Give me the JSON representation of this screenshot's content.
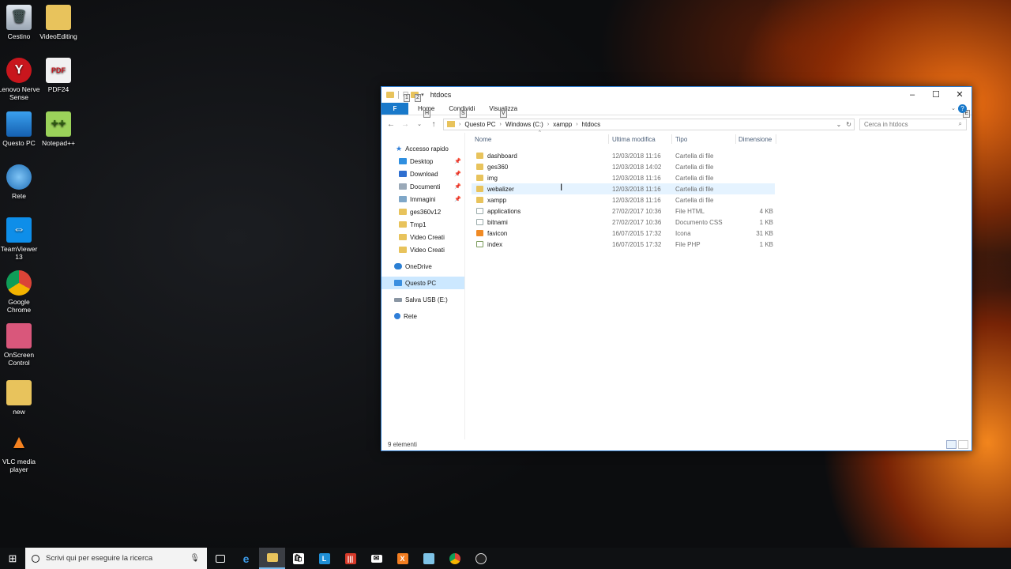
{
  "desktop": {
    "icons": [
      {
        "label": "Cestino",
        "icon": "recycle-bin-icon"
      },
      {
        "label": "VideoEditing",
        "icon": "folder-icon"
      },
      {
        "label": "Lenovo Nerve Sense",
        "icon": "lenovo-nerve-sense-icon"
      },
      {
        "label": "PDF24",
        "icon": "pdf24-icon"
      },
      {
        "label": "Questo PC",
        "icon": "this-pc-icon"
      },
      {
        "label": "Notepad++",
        "icon": "notepad-plus-plus-icon"
      },
      {
        "label": "Rete",
        "icon": "network-icon"
      },
      {
        "label": "TeamViewer 13",
        "icon": "teamviewer-icon"
      },
      {
        "label": "Google Chrome",
        "icon": "chrome-icon"
      },
      {
        "label": "OnScreen Control",
        "icon": "onscreen-control-icon"
      },
      {
        "label": "new",
        "icon": "folder-icon"
      },
      {
        "label": "VLC media player",
        "icon": "vlc-icon"
      }
    ]
  },
  "explorer": {
    "title": "htdocs",
    "keytips": [
      "1",
      "2",
      "H",
      "S",
      "V",
      "E"
    ],
    "ribbon": {
      "file_label": "F",
      "tabs": [
        "Home",
        "Condividi",
        "Visualizza"
      ]
    },
    "address": {
      "crumbs": [
        "Questo PC",
        "Windows (C:)",
        "xampp",
        "htdocs"
      ]
    },
    "search_placeholder": "Cerca in htdocs",
    "nav": {
      "quick_access": "Accesso rapido",
      "quick_items": [
        "Desktop",
        "Download",
        "Documenti",
        "Immagini",
        "ges360v12",
        "Tmp1",
        "Video Creati",
        "Video Creati"
      ],
      "onedrive": "OneDrive",
      "this_pc": "Questo PC",
      "usb": "Salva USB (E:)",
      "network": "Rete"
    },
    "columns": {
      "name": "Nome",
      "modified": "Ultima modifica",
      "type": "Tipo",
      "size": "Dimensione"
    },
    "files": [
      {
        "name": "dashboard",
        "date": "12/03/2018 11:16",
        "type": "Cartella di file",
        "size": ""
      },
      {
        "name": "ges360",
        "date": "12/03/2018 14:02",
        "type": "Cartella di file",
        "size": ""
      },
      {
        "name": "img",
        "date": "12/03/2018 11:16",
        "type": "Cartella di file",
        "size": ""
      },
      {
        "name": "webalizer",
        "date": "12/03/2018 11:16",
        "type": "Cartella di file",
        "size": ""
      },
      {
        "name": "xampp",
        "date": "12/03/2018 11:16",
        "type": "Cartella di file",
        "size": ""
      },
      {
        "name": "applications",
        "date": "27/02/2017 10:36",
        "type": "File HTML",
        "size": "4 KB"
      },
      {
        "name": "bitnami",
        "date": "27/02/2017 10:36",
        "type": "Documento CSS",
        "size": "1 KB"
      },
      {
        "name": "favicon",
        "date": "16/07/2015 17:32",
        "type": "Icona",
        "size": "31 KB"
      },
      {
        "name": "index",
        "date": "16/07/2015 17:32",
        "type": "File PHP",
        "size": "1 KB"
      }
    ],
    "status": "9 elementi"
  },
  "taskbar": {
    "search_placeholder": "Scrivi qui per eseguire la ricerca",
    "apps": [
      "task-view-icon",
      "edge-icon",
      "file-explorer-icon",
      "store-icon",
      "app-l-icon",
      "app-red-icon",
      "mail-icon",
      "xampp-icon",
      "app-blue-icon",
      "chrome-icon",
      "obs-icon"
    ]
  }
}
